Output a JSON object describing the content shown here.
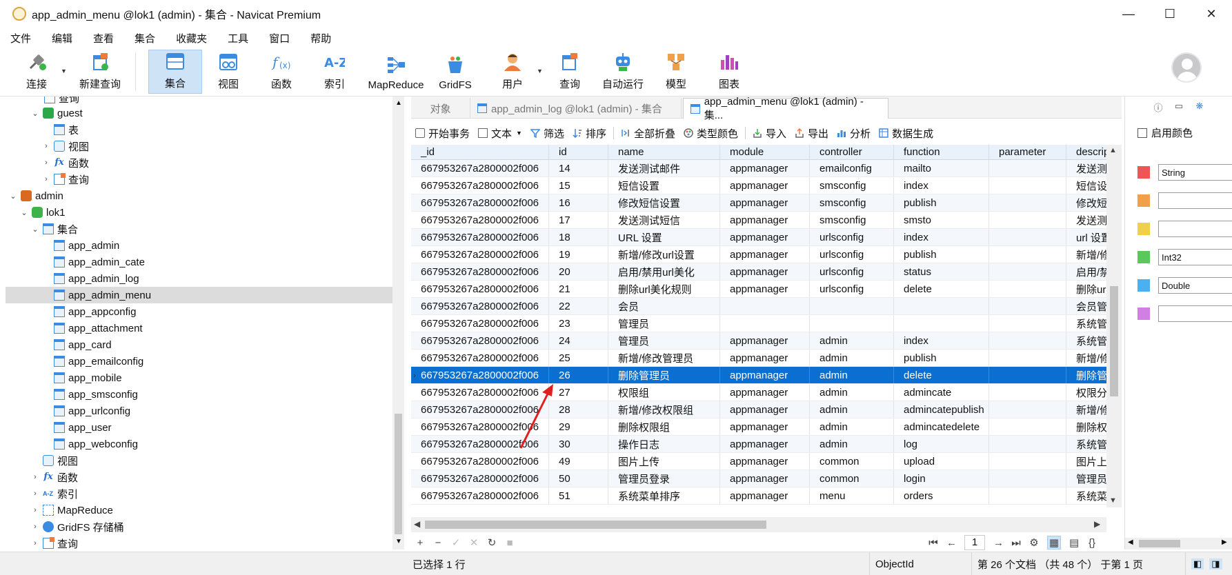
{
  "window": {
    "title": "app_admin_menu @lok1 (admin) - 集合 - Navicat Premium",
    "minimize": "—",
    "maximize": "☐",
    "close": "✕"
  },
  "menu": [
    "文件",
    "编辑",
    "查看",
    "集合",
    "收藏夹",
    "工具",
    "窗口",
    "帮助"
  ],
  "toolbar": {
    "connect": "连接",
    "new_query": "新建查询",
    "collection": "集合",
    "view": "视图",
    "function": "函数",
    "index": "索引",
    "mapreduce": "MapReduce",
    "gridfs": "GridFS",
    "user": "用户",
    "query": "查询",
    "automation": "自动运行",
    "model": "模型",
    "chart": "图表"
  },
  "tree": {
    "items": [
      {
        "label": "查询"
      },
      {
        "label": "guest"
      },
      {
        "label": "表"
      },
      {
        "label": "视图"
      },
      {
        "label": "函数"
      },
      {
        "label": "查询"
      },
      {
        "label": "admin"
      },
      {
        "label": "lok1"
      },
      {
        "label": "集合"
      },
      {
        "label": "app_admin"
      },
      {
        "label": "app_admin_cate"
      },
      {
        "label": "app_admin_log"
      },
      {
        "label": "app_admin_menu"
      },
      {
        "label": "app_appconfig"
      },
      {
        "label": "app_attachment"
      },
      {
        "label": "app_card"
      },
      {
        "label": "app_emailconfig"
      },
      {
        "label": "app_mobile"
      },
      {
        "label": "app_smsconfig"
      },
      {
        "label": "app_urlconfig"
      },
      {
        "label": "app_user"
      },
      {
        "label": "app_webconfig"
      },
      {
        "label": "视图"
      },
      {
        "label": "函数"
      },
      {
        "label": "索引"
      },
      {
        "label": "MapReduce"
      },
      {
        "label": "GridFS 存储桶"
      },
      {
        "label": "查询"
      }
    ]
  },
  "tabs": [
    "对象",
    "app_admin_log @lok1 (admin) - 集合",
    "app_admin_menu @lok1 (admin) - 集..."
  ],
  "grid_toolbar": {
    "begin_tx": "开始事务",
    "text": "文本",
    "filter": "筛选",
    "sort": "排序",
    "collapse": "全部折叠",
    "type_color": "类型颜色",
    "import": "导入",
    "export": "导出",
    "analyze": "分析",
    "data_gen": "数据生成"
  },
  "columns": [
    "_id",
    "id",
    "name",
    "module",
    "controller",
    "function",
    "parameter",
    "descript"
  ],
  "rows": [
    [
      "667953267a2800002f006",
      "14",
      "发送测试邮件",
      "appmanager",
      "emailconfig",
      "mailto",
      "",
      "发送测试"
    ],
    [
      "667953267a2800002f006",
      "15",
      "短信设置",
      "appmanager",
      "smsconfig",
      "index",
      "",
      "短信设置"
    ],
    [
      "667953267a2800002f006",
      "16",
      "修改短信设置",
      "appmanager",
      "smsconfig",
      "publish",
      "",
      "修改短信"
    ],
    [
      "667953267a2800002f006",
      "17",
      "发送测试短信",
      "appmanager",
      "smsconfig",
      "smsto",
      "",
      "发送测试"
    ],
    [
      "667953267a2800002f006",
      "18",
      "URL 设置",
      "appmanager",
      "urlsconfig",
      "index",
      "",
      "url 设置,"
    ],
    [
      "667953267a2800002f006",
      "19",
      "新增/修改url设置",
      "appmanager",
      "urlsconfig",
      "publish",
      "",
      "新增/修改"
    ],
    [
      "667953267a2800002f006",
      "20",
      "启用/禁用url美化",
      "appmanager",
      "urlsconfig",
      "status",
      "",
      "启用/禁用"
    ],
    [
      "667953267a2800002f006",
      "21",
      " 删除url美化规则",
      "appmanager",
      "urlsconfig",
      "delete",
      "",
      "删除url美"
    ],
    [
      "667953267a2800002f006",
      "22",
      "会员",
      "",
      "",
      "",
      "",
      "会员管理"
    ],
    [
      "667953267a2800002f006",
      "23",
      "管理员",
      "",
      "",
      "",
      "",
      "系统管理"
    ],
    [
      "667953267a2800002f006",
      "24",
      "管理员",
      "appmanager",
      "admin",
      "index",
      "",
      "系统管理"
    ],
    [
      "667953267a2800002f006",
      "25",
      "新增/修改管理员",
      "appmanager",
      "admin",
      "publish",
      "",
      "新增/修改"
    ],
    [
      "667953267a2800002f006",
      "26",
      "删除管理员",
      "appmanager",
      "admin",
      "delete",
      "",
      "删除管理"
    ],
    [
      "667953267a2800002f006",
      "27",
      "权限组",
      "appmanager",
      "admin",
      "admincate",
      "",
      "权限分组"
    ],
    [
      "667953267a2800002f006",
      "28",
      "新增/修改权限组",
      "appmanager",
      "admin",
      "admincatepublish",
      "",
      "新增/修改"
    ],
    [
      "667953267a2800002f006",
      "29",
      "删除权限组",
      "appmanager",
      "admin",
      "admincatedelete",
      "",
      "删除权限"
    ],
    [
      "667953267a2800002f006",
      "30",
      "操作日志",
      "appmanager",
      "admin",
      "log",
      "",
      "系统管理"
    ],
    [
      "667953267a2800002f006",
      "49",
      "图片上传",
      "appmanager",
      "common",
      "upload",
      "",
      "图片上传"
    ],
    [
      "667953267a2800002f006",
      "50",
      "管理员登录",
      "appmanager",
      "common",
      "login",
      "",
      "管理员登"
    ],
    [
      "667953267a2800002f006",
      "51",
      "系统菜单排序",
      "appmanager",
      "menu",
      "orders",
      "",
      "系统菜单"
    ]
  ],
  "pager": {
    "page": "1"
  },
  "status": {
    "selected": "已选择 1 行",
    "type": "ObjectId",
    "position": "第 26 个文档 （共 48 个） 于第 1 页"
  },
  "right_panel": {
    "enable_color": "启用颜色",
    "swatches": [
      {
        "color": "#f05454",
        "value": "String"
      },
      {
        "color": "#f0a04a",
        "value": ""
      },
      {
        "color": "#f0d04a",
        "value": ""
      },
      {
        "color": "#5ac85a",
        "value": "Int32"
      },
      {
        "color": "#4ab0f0",
        "value": "Double"
      },
      {
        "color": "#d080e0",
        "value": ""
      }
    ]
  }
}
